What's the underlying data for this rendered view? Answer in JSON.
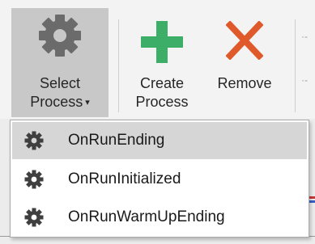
{
  "ribbon": {
    "select_process": {
      "label_line1": "Select",
      "label_line2": "Process",
      "caret": "▾",
      "icon": "gear-icon"
    },
    "create_process": {
      "label_line1": "Create",
      "label_line2": "Process",
      "icon": "plus-icon",
      "icon_color": "#3dae68"
    },
    "remove": {
      "label": "Remove",
      "icon": "x-icon",
      "icon_color": "#e0592b"
    }
  },
  "process_menu": {
    "items": [
      {
        "label": "OnRunEnding",
        "icon": "gear-icon",
        "highlighted": true
      },
      {
        "label": "OnRunInitialized",
        "icon": "gear-icon",
        "highlighted": false
      },
      {
        "label": "OnRunWarmUpEnding",
        "icon": "gear-icon",
        "highlighted": false
      }
    ]
  },
  "colors": {
    "gear_large": "#6b6b6b",
    "gear_small": "#3f3f3f",
    "menu_highlight": "#d6d6d6",
    "button_pressed": "#c8c8c8"
  }
}
